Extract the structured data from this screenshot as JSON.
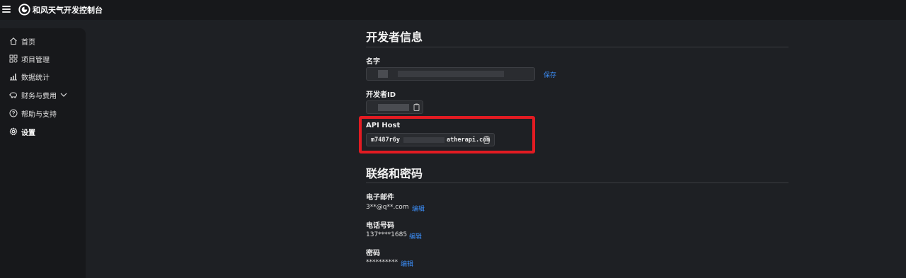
{
  "app": {
    "title": "和风天气开发控制台",
    "menu_icon": "hamburger-menu-icon",
    "logo_icon": "qweather-logo-icon"
  },
  "sidebar": {
    "items": [
      {
        "label": "首页",
        "icon": "home-icon"
      },
      {
        "label": "项目管理",
        "icon": "apps-icon"
      },
      {
        "label": "数据统计",
        "icon": "bar-chart-icon"
      },
      {
        "label": "财务与费用",
        "icon": "piggy-bank-icon",
        "expand_icon": "chevron-down-icon"
      },
      {
        "label": "帮助与支持",
        "icon": "help-circle-icon"
      },
      {
        "label": "设置",
        "icon": "gear-icon",
        "active": true
      }
    ]
  },
  "developer_info": {
    "title": "开发者信息",
    "name": {
      "label": "名字",
      "save_label": "保存"
    },
    "developer_id": {
      "label": "开发者ID",
      "copy_icon": "clipboard-icon"
    },
    "api_host": {
      "label": "API Host",
      "value_prefix": "m7487r6y",
      "value_suffix": "atherapi.com",
      "copy_icon": "clipboard-icon"
    }
  },
  "contact": {
    "title": "联络和密码",
    "email": {
      "label": "电子邮件",
      "value": "3**@q**.com",
      "edit_label": "编辑"
    },
    "phone": {
      "label": "电话号码",
      "value": "137****1685",
      "edit_label": "编辑"
    },
    "password": {
      "label": "密码",
      "value": "**********",
      "edit_label": "编辑"
    }
  },
  "colors": {
    "background": "#1e2024",
    "panel": "#17181b",
    "link": "#3b8cf5",
    "highlight_border": "#e21b22"
  }
}
